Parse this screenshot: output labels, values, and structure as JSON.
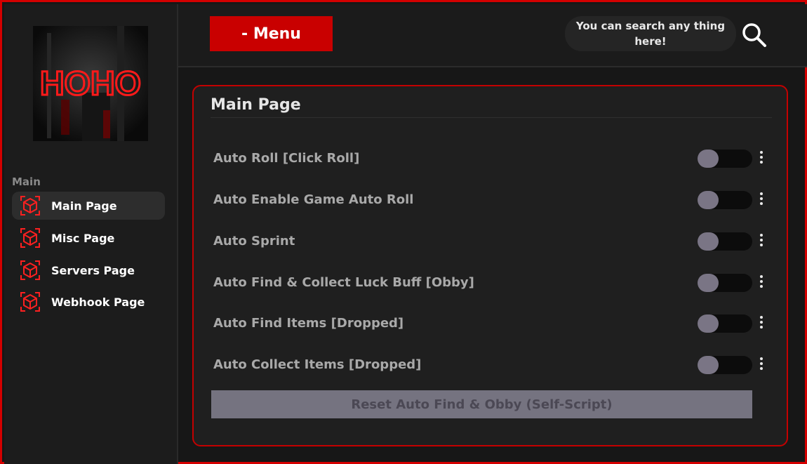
{
  "brand": {
    "logo_text": "HOHO",
    "accent": "#d40000"
  },
  "header": {
    "menu_label": "- Menu",
    "search_text": "You can search any thing here!",
    "search_icon": "magnifier"
  },
  "sidebar": {
    "section_label": "Main",
    "items": [
      {
        "label": "Main Page",
        "icon": "cube-icon",
        "active": true
      },
      {
        "label": "Misc Page",
        "icon": "cube-icon",
        "active": false
      },
      {
        "label": "Servers Page",
        "icon": "cube-icon",
        "active": false
      },
      {
        "label": "Webhook Page",
        "icon": "cube-icon",
        "active": false
      }
    ]
  },
  "main": {
    "title": "Main Page",
    "toggles": [
      {
        "label": "Auto Roll [Click Roll]",
        "on": false
      },
      {
        "label": "Auto Enable Game Auto Roll",
        "on": false
      },
      {
        "label": "Auto Sprint",
        "on": false
      },
      {
        "label": "Auto Find & Collect Luck Buff [Obby]",
        "on": false
      },
      {
        "label": "Auto Find Items [Dropped]",
        "on": false
      },
      {
        "label": "Auto Collect Items [Dropped]",
        "on": false
      }
    ],
    "reset_label": "Reset Auto Find & Obby (Self-Script)"
  }
}
